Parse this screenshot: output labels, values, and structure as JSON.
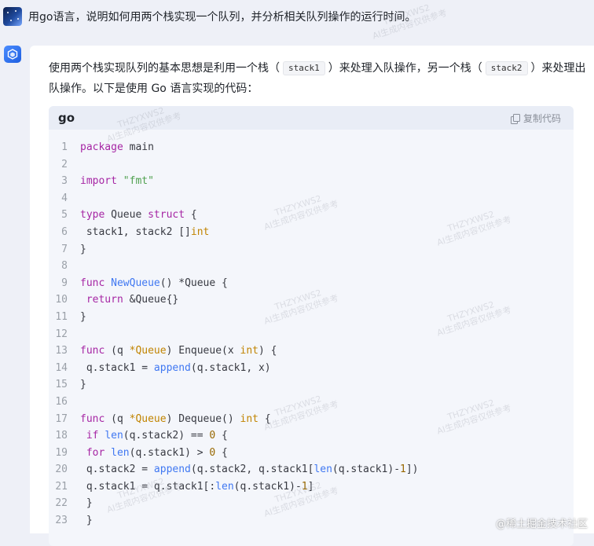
{
  "user_message": {
    "text": "用go语言，说明如何用两个栈实现一个队列，并分析相关队列操作的运行时间。"
  },
  "answer": {
    "intro_part1": "使用两个栈实现队列的基本思想是利用一个栈（",
    "intro_chip1": "stack1",
    "intro_part2": "）来处理入队操作，另一个栈（",
    "intro_chip2": "stack2",
    "intro_part3": "）来处理出队操作。以下是使用 Go 语言实现的代码："
  },
  "code_block": {
    "language": "go",
    "copy_label": "复制代码",
    "lines": [
      {
        "n": "1",
        "html": "<span class=\"kw\">package</span> main"
      },
      {
        "n": "2",
        "html": ""
      },
      {
        "n": "3",
        "html": "<span class=\"kw\">import</span> <span class=\"st\">\"fmt\"</span>"
      },
      {
        "n": "4",
        "html": ""
      },
      {
        "n": "5",
        "html": "<span class=\"kw\">type</span> Queue <span class=\"kw\">struct</span> {"
      },
      {
        "n": "6",
        "html": " stack1, stack2 []<span class=\"ty\">int</span>"
      },
      {
        "n": "7",
        "html": "}"
      },
      {
        "n": "8",
        "html": ""
      },
      {
        "n": "9",
        "html": "<span class=\"kw\">func</span> <span class=\"fn\">NewQueue</span>() *Queue {"
      },
      {
        "n": "10",
        "html": " <span class=\"kw\">return</span> &amp;Queue{}"
      },
      {
        "n": "11",
        "html": "}"
      },
      {
        "n": "12",
        "html": ""
      },
      {
        "n": "13",
        "html": "<span class=\"kw\">func</span> (q <span class=\"ty\">*Queue</span>) Enqueue(x <span class=\"ty\">int</span>) {"
      },
      {
        "n": "14",
        "html": " q.stack1 = <span class=\"fn\">append</span>(q.stack1, x)"
      },
      {
        "n": "15",
        "html": "}"
      },
      {
        "n": "16",
        "html": ""
      },
      {
        "n": "17",
        "html": "<span class=\"kw\">func</span> (q <span class=\"ty\">*Queue</span>) Dequeue() <span class=\"ty\">int</span> {"
      },
      {
        "n": "18",
        "html": " <span class=\"kw\">if</span> <span class=\"fn\">len</span>(q.stack2) == <span class=\"nu\">0</span> {"
      },
      {
        "n": "19",
        "html": " <span class=\"kw\">for</span> <span class=\"fn\">len</span>(q.stack1) &gt; <span class=\"nu\">0</span> {"
      },
      {
        "n": "20",
        "html": " q.stack2 = <span class=\"fn\">append</span>(q.stack2, q.stack1[<span class=\"fn\">len</span>(q.stack1)-<span class=\"nu\">1</span>])"
      },
      {
        "n": "21",
        "html": " q.stack1 = q.stack1[:<span class=\"fn\">len</span>(q.stack1)-<span class=\"nu\">1</span>]"
      },
      {
        "n": "22",
        "html": " }"
      },
      {
        "n": "23",
        "html": " }"
      }
    ]
  },
  "watermark": {
    "line1": "THZYXWS2",
    "line2": "AI生成内容仅供参考"
  },
  "footer_brand": {
    "text": "@稀土掘金技术社区"
  },
  "colors": {
    "accent": "#1e5fe0",
    "keyword": "#a626a4",
    "type": "#c18401",
    "string": "#50a14f",
    "function": "#4078f2",
    "number": "#986801"
  }
}
